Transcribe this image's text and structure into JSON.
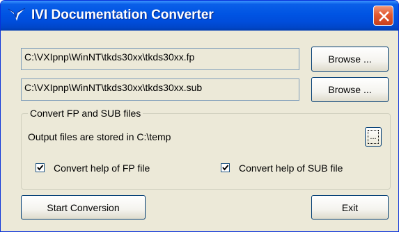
{
  "window": {
    "title": "IVI Documentation Converter",
    "icon": "ni-eagle-icon",
    "close_icon": "close-icon"
  },
  "files": {
    "fp_path": "C:\\VXIpnp\\WinNT\\tkds30xx\\tkds30xx.fp",
    "sub_path": "C:\\VXIpnp\\WinNT\\tkds30xx\\tkds30xx.sub",
    "browse_label": "Browse ..."
  },
  "convert_group": {
    "legend": "Convert FP and SUB files",
    "output_text": "Output files are stored in C:\\temp",
    "dir_button_label": "...",
    "help_fp_label": "Convert help of FP file",
    "help_fp_checked": true,
    "help_sub_label": "Convert help of SUB file",
    "help_sub_checked": true
  },
  "actions": {
    "start_label": "Start Conversion",
    "exit_label": "Exit"
  },
  "colors": {
    "titlebar": "#0054e3",
    "close_button": "#e35a31",
    "dialog_bg": "#ece9d8"
  }
}
